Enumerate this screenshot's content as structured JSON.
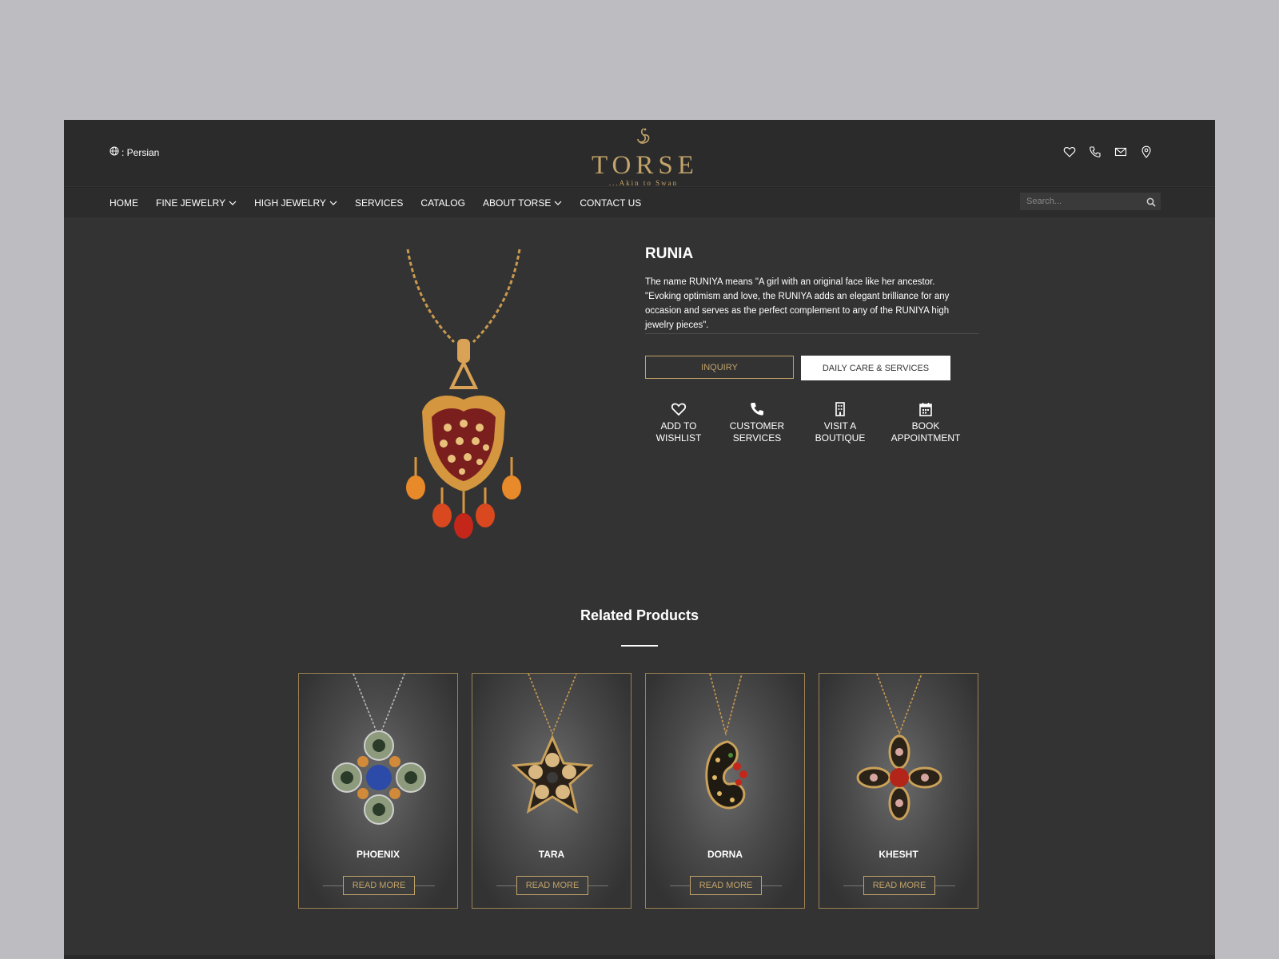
{
  "header": {
    "language_label": ": Persian",
    "logo_text": "TORSE",
    "logo_tagline": "...Akin to Swan",
    "icons": [
      "heart-icon",
      "phone-icon",
      "mail-icon",
      "location-icon"
    ]
  },
  "nav": {
    "items": [
      {
        "label": "HOME"
      },
      {
        "label": "FINE JEWELRY"
      },
      {
        "label": "HIGH JEWELRY"
      },
      {
        "label": "SERVICES"
      },
      {
        "label": "CATALOG"
      },
      {
        "label": "ABOUT TORSE"
      },
      {
        "label": "CONTACT US"
      }
    ],
    "search_placeholder": "Search..."
  },
  "product": {
    "title": "RUNIA",
    "description": "The name RUNIYA means \"A girl with an original face like her ancestor. \"Evoking optimism and love, the RUNIYA adds an elegant brilliance for any occasion and serves as the perfect complement to any of the RUNIYA high jewelry pieces\".",
    "inquiry_label": "INQUIRY",
    "care_label": "DAILY CARE & SERVICES",
    "actions": [
      {
        "line1": "ADD TO",
        "line2": "WISHLIST",
        "icon": "heart-icon"
      },
      {
        "line1": "CUSTOMER",
        "line2": "SERVICES",
        "icon": "phone-icon"
      },
      {
        "line1": "VISIT A",
        "line2": "BOUTIQUE",
        "icon": "building-icon"
      },
      {
        "line1": "BOOK",
        "line2": "APPOINTMENT",
        "icon": "calendar-icon"
      }
    ]
  },
  "related": {
    "title": "Related Products",
    "products": [
      {
        "name": "PHOENIX",
        "button": "READ MORE"
      },
      {
        "name": "TARA",
        "button": "READ MORE"
      },
      {
        "name": "DORNA",
        "button": "READ MORE"
      },
      {
        "name": "KHESHT",
        "button": "READ MORE"
      }
    ]
  },
  "colors": {
    "page_bg": "#333333",
    "header_bg": "#2b2b2b",
    "gold_accent": "#c2a36a",
    "outer_bg": "#bdbcc1"
  }
}
